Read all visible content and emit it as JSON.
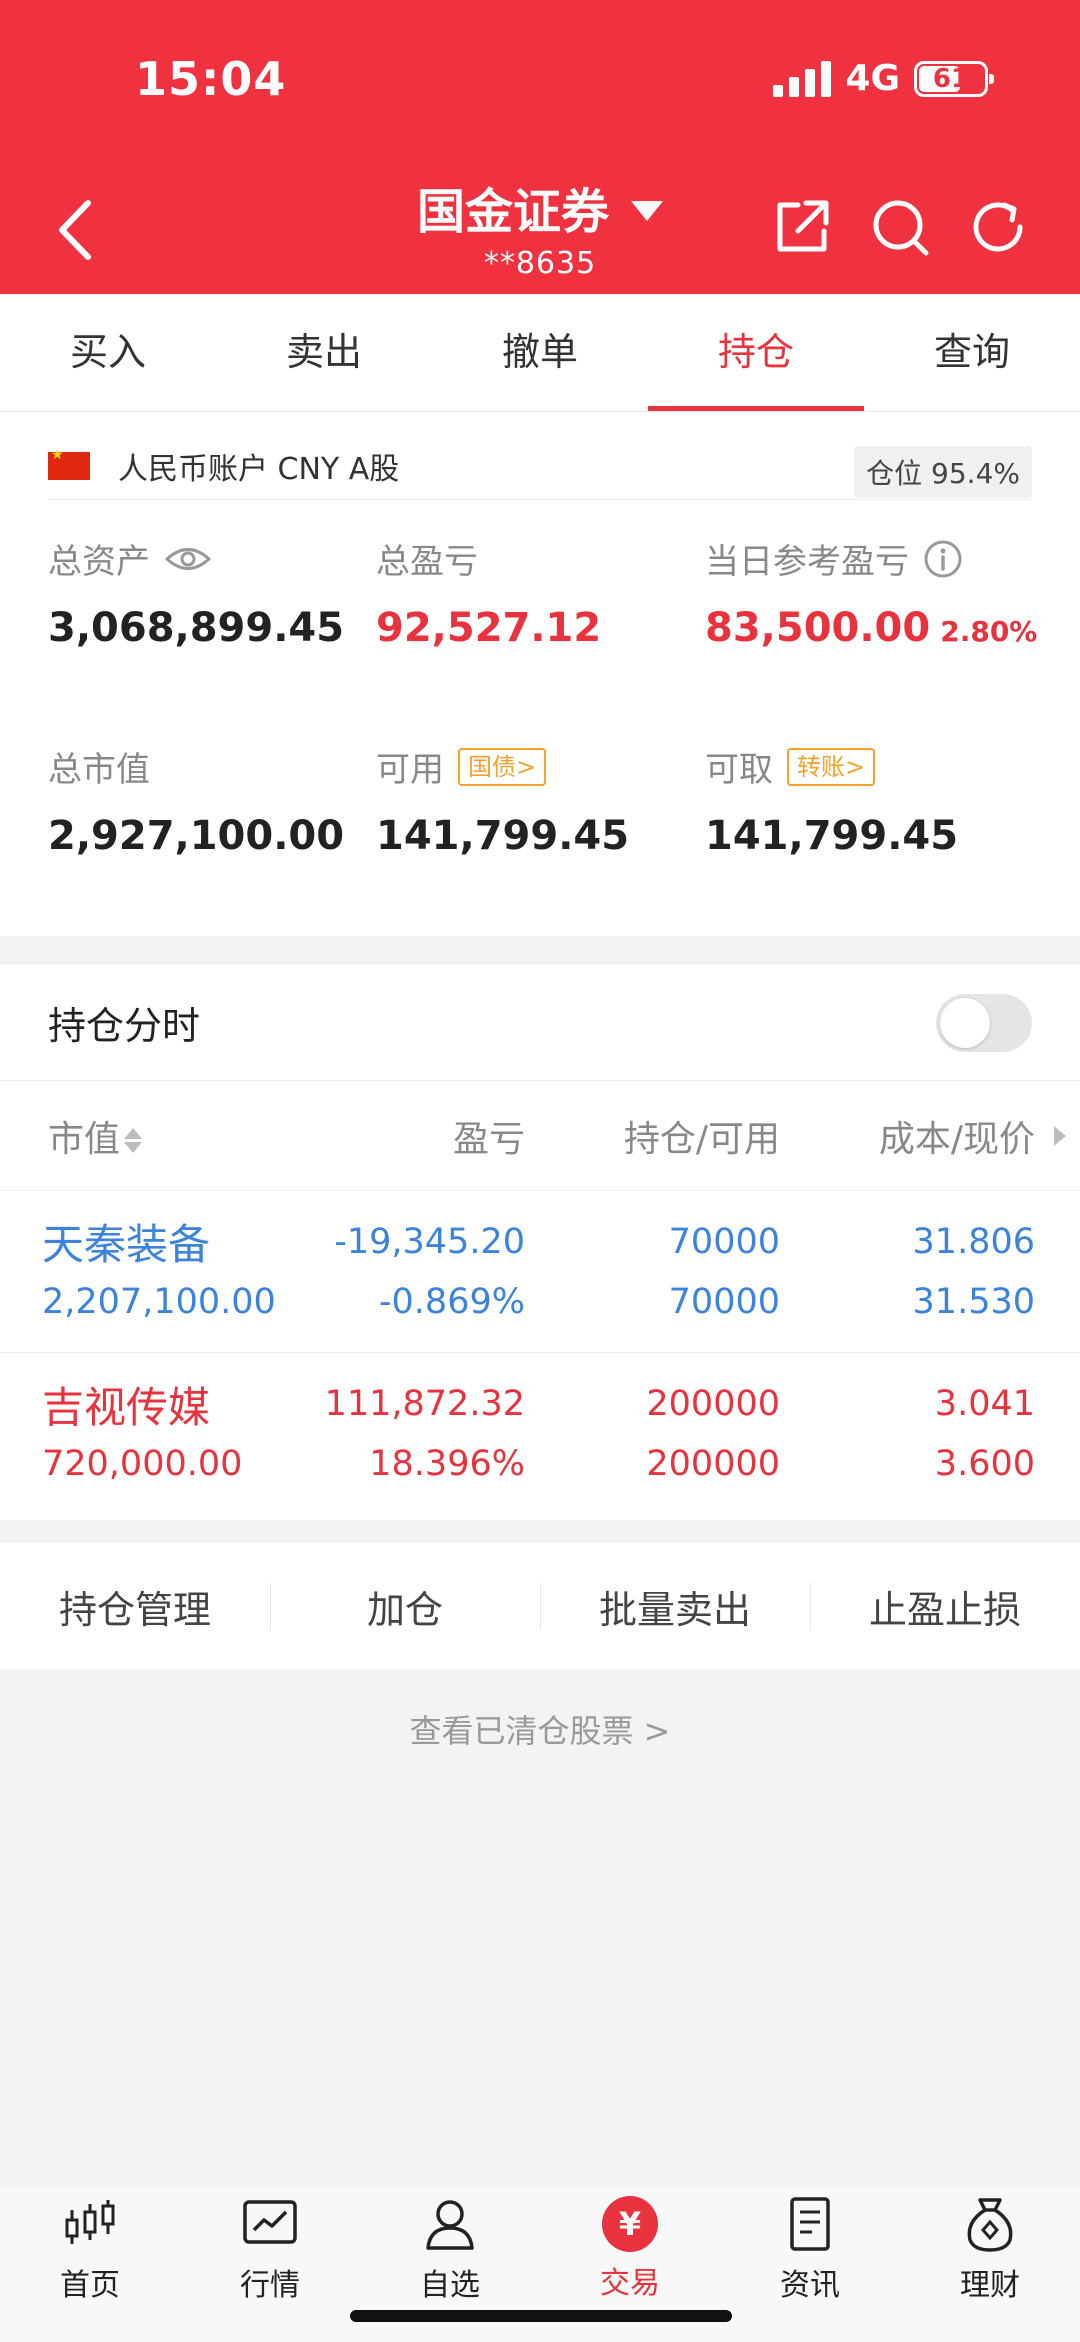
{
  "status": {
    "time": "15:04",
    "network": "4G",
    "battery": "61"
  },
  "header": {
    "title": "国金证券",
    "account": "**8635"
  },
  "tabs": [
    {
      "label": "买入"
    },
    {
      "label": "卖出"
    },
    {
      "label": "撤单"
    },
    {
      "label": "持仓",
      "active": true
    },
    {
      "label": "查询"
    }
  ],
  "account_bar": {
    "label": "人民币账户 CNY A股",
    "position": "仓位 95.4%"
  },
  "summary": {
    "total_assets": {
      "label": "总资产",
      "value": "3,068,899.45"
    },
    "total_pnl": {
      "label": "总盈亏",
      "value": "92,527.12"
    },
    "daily_pnl": {
      "label": "当日参考盈亏",
      "value": "83,500.00",
      "pct": "2.80%"
    },
    "market_value": {
      "label": "总市值",
      "value": "2,927,100.00"
    },
    "available": {
      "label": "可用",
      "tag": "国债>",
      "value": "141,799.45"
    },
    "withdrawable": {
      "label": "可取",
      "tag": "转账>",
      "value": "141,799.45"
    }
  },
  "holdings": {
    "toggle_label": "持仓分时",
    "columns": [
      "市值",
      "盈亏",
      "持仓/可用",
      "成本/现价"
    ],
    "rows": [
      {
        "name": "天秦装备",
        "market_value": "2,207,100.00",
        "pnl": "-19,345.20",
        "pnl_pct": "-0.869%",
        "position": "70000",
        "available": "70000",
        "cost": "31.806",
        "price": "31.530",
        "color": "#3b83dc"
      },
      {
        "name": "吉视传媒",
        "market_value": "720,000.00",
        "pnl": "111,872.32",
        "pnl_pct": "18.396%",
        "position": "200000",
        "available": "200000",
        "cost": "3.041",
        "price": "3.600",
        "color": "#e8323d"
      }
    ]
  },
  "actions": [
    "持仓管理",
    "加仓",
    "批量卖出",
    "止盈止损"
  ],
  "cleared_link": "查看已清仓股票 >",
  "tabbar": [
    {
      "label": "首页",
      "icon": "candlestick-icon"
    },
    {
      "label": "行情",
      "icon": "chart-icon"
    },
    {
      "label": "自选",
      "icon": "person-icon"
    },
    {
      "label": "交易",
      "icon": "yuan-icon",
      "active": true,
      "glyph": "¥"
    },
    {
      "label": "资讯",
      "icon": "document-icon"
    },
    {
      "label": "理财",
      "icon": "money-bag-icon"
    }
  ],
  "colors": {
    "brand": "#f0313f",
    "up": "#e8323d",
    "down": "#3b83dc",
    "tag": "#f6a12b"
  }
}
